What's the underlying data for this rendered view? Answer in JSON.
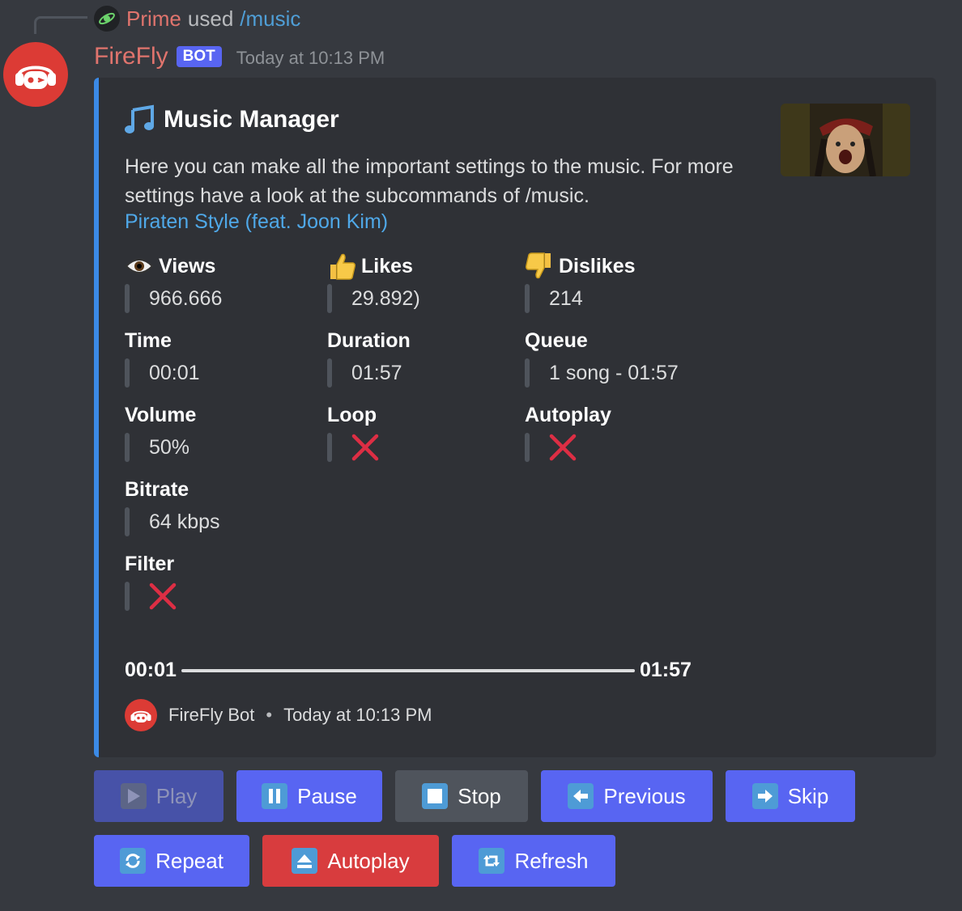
{
  "reply": {
    "user": "Prime",
    "used": "used",
    "command": "/music"
  },
  "message": {
    "username": "FireFly",
    "bot_tag": "BOT",
    "timestamp": "Today at 10:13 PM"
  },
  "embed": {
    "accent_color": "#3b8ae6",
    "title": "Music Manager",
    "title_icon": "musical-note-icon",
    "description": "Here you can make all the important settings to the music. For more settings have a look at the subcommands of /music.",
    "song_link": "Piraten Style (feat. Joon Kim)",
    "fields": {
      "views": {
        "name": "Views",
        "icon": "eye-icon",
        "value": "966.666"
      },
      "likes": {
        "name": "Likes",
        "icon": "thumbs-up-icon",
        "value": "29.892)"
      },
      "dislikes": {
        "name": "Dislikes",
        "icon": "thumbs-down-icon",
        "value": "214"
      },
      "time": {
        "name": "Time",
        "value": "00:01"
      },
      "duration": {
        "name": "Duration",
        "value": "01:57"
      },
      "queue": {
        "name": "Queue",
        "value": "1 song - 01:57"
      },
      "volume": {
        "name": "Volume",
        "value": "50%"
      },
      "loop": {
        "name": "Loop",
        "value_icon": "cross-mark-icon"
      },
      "autoplay": {
        "name": "Autoplay",
        "value_icon": "cross-mark-icon"
      },
      "bitrate": {
        "name": "Bitrate",
        "value": "64 kbps"
      },
      "filter": {
        "name": "Filter",
        "value_icon": "cross-mark-icon"
      }
    },
    "progress": {
      "current": "00:01",
      "total": "01:57",
      "fraction": 0.009
    },
    "footer": {
      "name": "FireFly Bot",
      "separator": "•",
      "timestamp": "Today at 10:13 PM"
    }
  },
  "buttons": {
    "play": "Play",
    "pause": "Pause",
    "stop": "Stop",
    "previous": "Previous",
    "skip": "Skip",
    "repeat": "Repeat",
    "autoplay": "Autoplay",
    "refresh": "Refresh"
  },
  "colors": {
    "background": "#36393f",
    "embed_bg": "#2f3136",
    "brand_red": "#dc3b35",
    "blurple": "#5865f2",
    "danger": "#d83c3e",
    "link": "#4fa8e8",
    "cross": "#dd2e44"
  }
}
